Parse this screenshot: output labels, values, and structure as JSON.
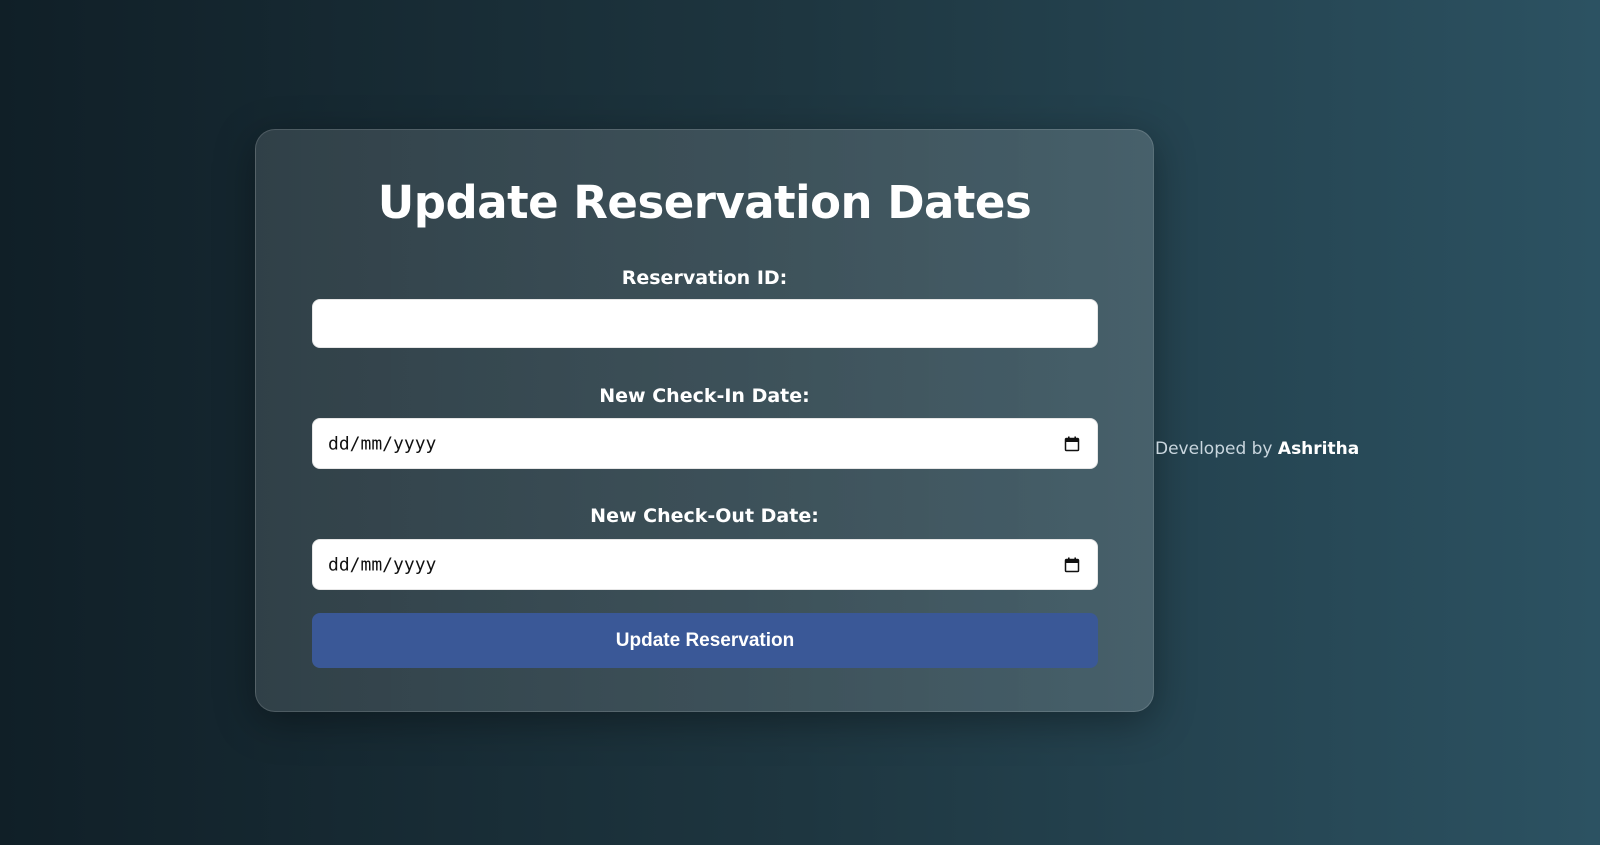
{
  "form": {
    "title": "Update Reservation Dates",
    "fields": [
      {
        "label": "Reservation ID:",
        "value": "",
        "placeholder": ""
      },
      {
        "label": "New Check-In Date:",
        "placeholder": "dd/mm/yyyy"
      },
      {
        "label": "New Check-Out Date:",
        "placeholder": "dd/mm/yyyy"
      }
    ],
    "submit_label": "Update Reservation"
  },
  "footer": {
    "prefix": "Developed by",
    "author": "Ashritha"
  },
  "icons": {
    "date_picker": "calendar-icon"
  },
  "colors": {
    "button": "#3a5897",
    "background_start": "#101f27",
    "background_end": "#2c5262"
  }
}
